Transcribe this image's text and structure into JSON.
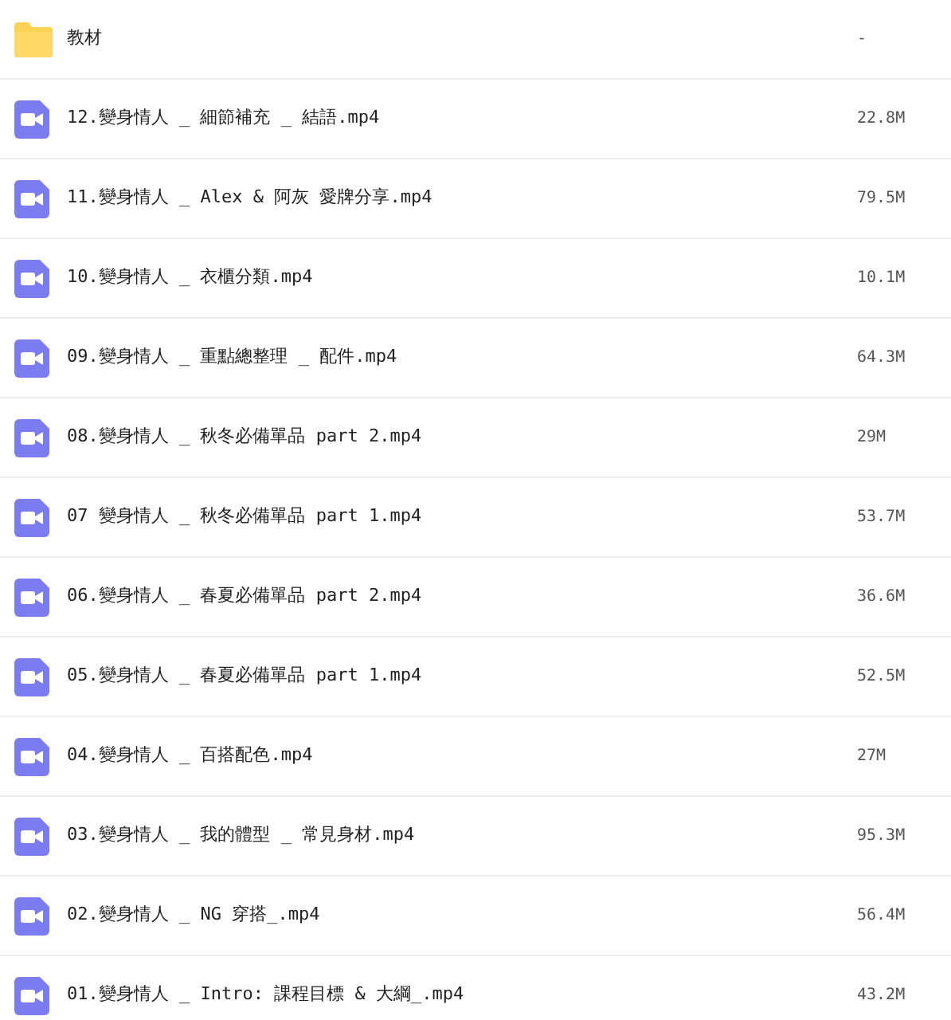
{
  "files": [
    {
      "kind": "folder",
      "name": "教材",
      "size": "-"
    },
    {
      "kind": "video",
      "name": "12.變身情人 _ 細節補充 _ 結語.mp4",
      "size": "22.8M"
    },
    {
      "kind": "video",
      "name": "11.變身情人 _ Alex & 阿灰 愛牌分享.mp4",
      "size": "79.5M"
    },
    {
      "kind": "video",
      "name": "10.變身情人 _ 衣櫃分類.mp4",
      "size": "10.1M"
    },
    {
      "kind": "video",
      "name": "09.變身情人 _ 重點總整理 _ 配件.mp4",
      "size": "64.3M"
    },
    {
      "kind": "video",
      "name": "08.變身情人 _ 秋冬必備單品 part 2.mp4",
      "size": "29M"
    },
    {
      "kind": "video",
      "name": "07 變身情人 _ 秋冬必備單品 part 1.mp4",
      "size": "53.7M"
    },
    {
      "kind": "video",
      "name": "06.變身情人 _ 春夏必備單品 part 2.mp4",
      "size": "36.6M"
    },
    {
      "kind": "video",
      "name": "05.變身情人 _ 春夏必備單品 part 1.mp4",
      "size": "52.5M"
    },
    {
      "kind": "video",
      "name": "04.變身情人 _ 百搭配色.mp4",
      "size": "27M"
    },
    {
      "kind": "video",
      "name": "03.變身情人 _ 我的體型 _ 常見身材.mp4",
      "size": "95.3M"
    },
    {
      "kind": "video",
      "name": "02.變身情人 _ NG 穿搭_.mp4",
      "size": "56.4M"
    },
    {
      "kind": "video",
      "name": "01.變身情人 _ Intro: 課程目標 & 大綱_.mp4",
      "size": "43.2M"
    }
  ]
}
